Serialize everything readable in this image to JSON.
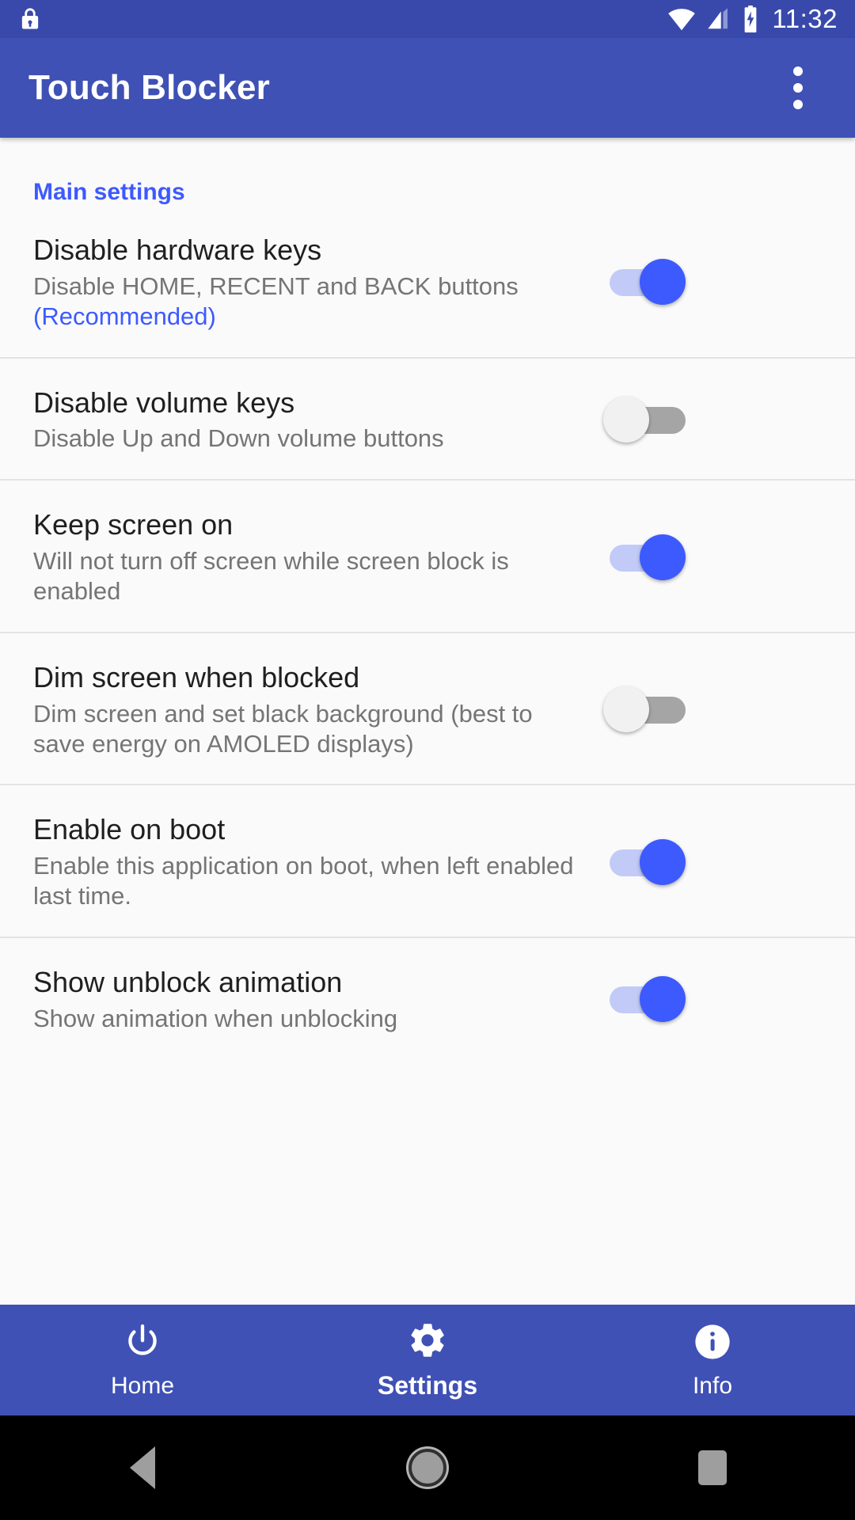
{
  "status_bar": {
    "lock_icon": "lock-icon",
    "wifi_icon": "wifi-icon",
    "signal_icon": "cellular-signal-icon",
    "battery_icon": "battery-charging-icon",
    "time": "11:32",
    "background_color": "#3949ab"
  },
  "app_bar": {
    "title": "Touch Blocker",
    "overflow_icon": "overflow-menu-icon",
    "background_color": "#3f51b5"
  },
  "settings": {
    "category_title": "Main settings",
    "accent_color": "#3d5afe",
    "items": [
      {
        "title": "Disable hardware keys",
        "summary": "Disable HOME, RECENT and BACK buttons ",
        "summary_highlight": "(Recommended)",
        "state": "on"
      },
      {
        "title": "Disable volume keys",
        "summary": "Disable Up and Down volume buttons",
        "summary_highlight": "",
        "state": "off"
      },
      {
        "title": "Keep screen on",
        "summary": "Will not turn off screen while screen block is enabled",
        "summary_highlight": "",
        "state": "on"
      },
      {
        "title": "Dim screen when blocked",
        "summary": "Dim screen and set black background (best to save energy on AMOLED displays)",
        "summary_highlight": "",
        "state": "off"
      },
      {
        "title": "Enable on boot",
        "summary": "Enable this application on boot, when left enabled last time.",
        "summary_highlight": "",
        "state": "on"
      },
      {
        "title": "Show unblock animation",
        "summary": "Show animation when unblocking",
        "summary_highlight": "",
        "state": "on"
      }
    ]
  },
  "bottom_nav": {
    "items": [
      {
        "label": "Home",
        "icon": "power-icon",
        "active": false
      },
      {
        "label": "Settings",
        "icon": "gear-icon",
        "active": true
      },
      {
        "label": "Info",
        "icon": "info-icon",
        "active": false
      }
    ],
    "background_color": "#3f51b5"
  },
  "system_nav": {
    "back": "back-triangle-icon",
    "home": "home-circle-icon",
    "recents": "recents-square-icon"
  }
}
